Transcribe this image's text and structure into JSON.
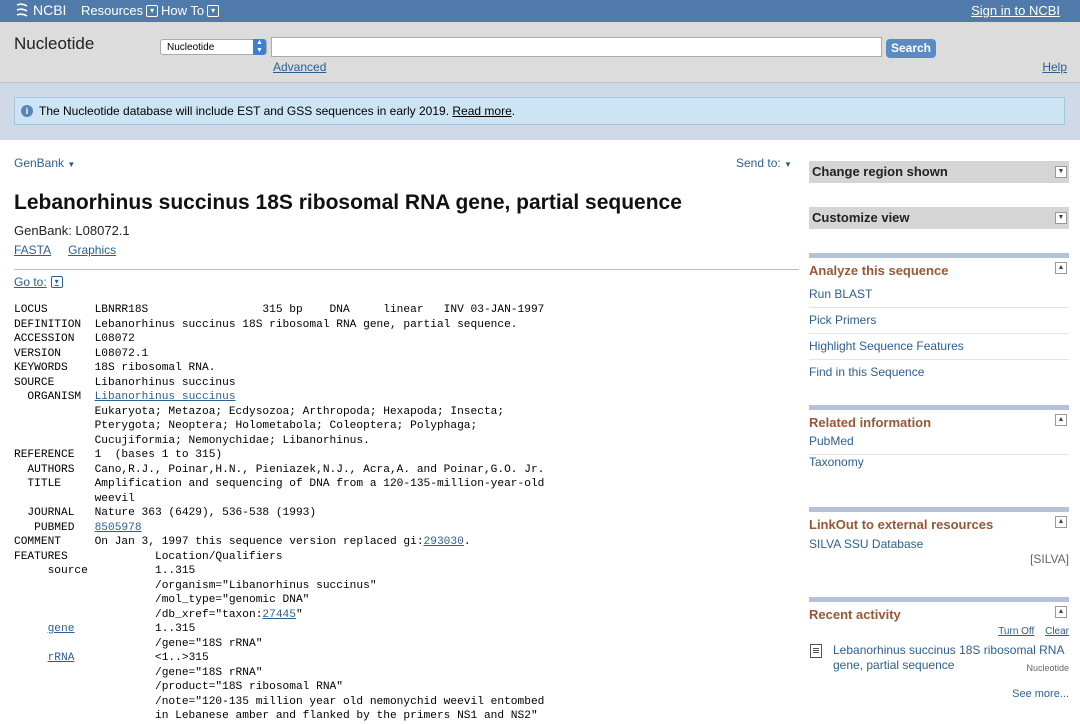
{
  "topbar": {
    "logo_text": "NCBI",
    "resources_label": "Resources",
    "howto_label": "How To",
    "signin_label": "Sign in to NCBI"
  },
  "search": {
    "db_title": "Nucleotide",
    "db_selected": "Nucleotide",
    "query_value": "",
    "button_label": "Search",
    "advanced_label": "Advanced",
    "help_label": "Help"
  },
  "notice": {
    "text": "The Nucleotide database will include EST and GSS sequences in early 2019.",
    "link": "Read more",
    "end": "."
  },
  "record_header": {
    "format_label": "GenBank",
    "sendto_label": "Send to:",
    "title": "Lebanorhinus succinus 18S ribosomal RNA gene, partial sequence",
    "accession_line": "GenBank: L08072.1",
    "fasta_label": "FASTA",
    "graphics_label": "Graphics",
    "goto_label": "Go to:"
  },
  "record": {
    "locus": "LOCUS       LBNRR18S                 315 bp    DNA     linear   INV 03-JAN-1997",
    "definition": "DEFINITION  Lebanorhinus succinus 18S ribosomal RNA gene, partial sequence.",
    "accession": "ACCESSION   L08072",
    "version": "VERSION     L08072.1",
    "keywords": "KEYWORDS    18S ribosomal RNA.",
    "source": "SOURCE      Libanorhinus succinus",
    "organism_label": "  ORGANISM  ",
    "organism_link": "Libanorhinus succinus",
    "tax1": "            Eukaryota; Metazoa; Ecdysozoa; Arthropoda; Hexapoda; Insecta;",
    "tax2": "            Pterygota; Neoptera; Holometabola; Coleoptera; Polyphaga;",
    "tax3": "            Cucujiformia; Nemonychidae; Libanorhinus.",
    "reference": "REFERENCE   1  (bases 1 to 315)",
    "authors": "  AUTHORS   Cano,R.J., Poinar,H.N., Pieniazek,N.J., Acra,A. and Poinar,G.O. Jr.",
    "title1": "  TITLE     Amplification and sequencing of DNA from a 120-135-million-year-old",
    "title2": "            weevil",
    "journal": "  JOURNAL   Nature 363 (6429), 536-538 (1993)",
    "pubmed_label": "   PUBMED   ",
    "pubmed_link": "8505978",
    "comment_pre": "COMMENT     On Jan 3, 1997 this sequence version replaced gi:",
    "comment_link": "293030",
    "comment_post": ".",
    "features": "FEATURES             Location/Qualifiers",
    "source_key": "     source          1..315",
    "q_organism": "                     /organism=\"Libanorhinus succinus\"",
    "q_moltype": "                     /mol_type=\"genomic DNA\"",
    "q_dbxref_pre": "                     /db_xref=\"taxon:",
    "q_dbxref_link": "27445",
    "q_dbxref_post": "\"",
    "gene_indent": "     ",
    "gene_link": "gene",
    "gene_loc": "            1..315",
    "q_gene1": "                     /gene=\"18S rRNA\"",
    "rrna_indent": "     ",
    "rrna_link": "rRNA",
    "rrna_loc": "            <1..>315",
    "q_gene2": "                     /gene=\"18S rRNA\"",
    "q_product": "                     /product=\"18S ribosomal RNA\"",
    "q_note1": "                     /note=\"120-135 million year old nemonychid weevil entombed",
    "q_note2": "                     in Lebanese amber and flanked by the primers NS1 and NS2\""
  },
  "sidebar": {
    "change_region": "Change region shown",
    "customize_view": "Customize view",
    "analyze": {
      "heading": "Analyze this sequence",
      "items": [
        "Run BLAST",
        "Pick Primers",
        "Highlight Sequence Features",
        "Find in this Sequence"
      ]
    },
    "related": {
      "heading": "Related information",
      "items": [
        "PubMed",
        "Taxonomy"
      ]
    },
    "linkout": {
      "heading": "LinkOut to external resources",
      "item": "SILVA SSU Database",
      "tag": "[SILVA]"
    },
    "recent": {
      "heading": "Recent activity",
      "turn_off": "Turn Off",
      "clear": "Clear",
      "item": "Lebanorhinus succinus 18S ribosomal RNA gene, partial sequence",
      "item_db": "Nucleotide",
      "see_more": "See more..."
    }
  }
}
